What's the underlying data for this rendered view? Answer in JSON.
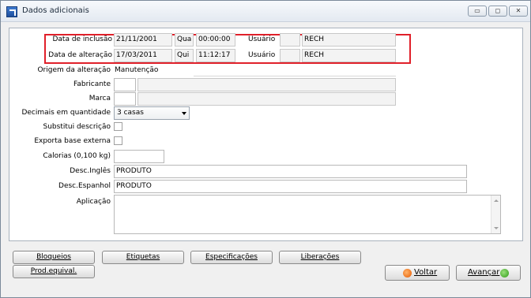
{
  "window": {
    "title": "Dados adicionais",
    "controls": {
      "minimize": "▭",
      "restore": "◻",
      "close": "✕"
    }
  },
  "audit": {
    "inclusao": {
      "label": "Data de inclusão",
      "date": "21/11/2001",
      "weekday": "Qua",
      "time": "00:00:00",
      "user_label": "Usuário",
      "user_code": "",
      "user": "RECH"
    },
    "alteracao": {
      "label": "Data de alteração",
      "date": "17/03/2011",
      "weekday": "Qui",
      "time": "11:12:17",
      "user_label": "Usuário",
      "user_code": "",
      "user": "RECH"
    }
  },
  "form": {
    "origem": {
      "label": "Origem da alteração",
      "value": "Manutenção"
    },
    "fabricante": {
      "label": "Fabricante",
      "code": "",
      "name": ""
    },
    "marca": {
      "label": "Marca",
      "code": "",
      "name": ""
    },
    "decimais": {
      "label": "Decimais em quantidade",
      "selected": "3 casas"
    },
    "substitui": {
      "label": "Substitui descrição"
    },
    "exporta": {
      "label": "Exporta base externa"
    },
    "calorias": {
      "label": "Calorias (0,100 kg)",
      "value": ""
    },
    "desc_ingles": {
      "label": "Desc.Inglês",
      "value": "PRODUTO"
    },
    "desc_espanhol": {
      "label": "Desc.Espanhol",
      "value": "PRODUTO"
    },
    "aplicacao": {
      "label": "Aplicação",
      "value": ""
    }
  },
  "buttons": {
    "bloqueios": "Bloqueios",
    "etiquetas": "Etiquetas",
    "especificacoes": "Especificações",
    "liberacoes": "Liberações",
    "prod_equival": "Prod.equival.",
    "voltar": "Voltar",
    "avancar": "Avançar"
  },
  "colors": {
    "highlight": "#e0202a"
  }
}
